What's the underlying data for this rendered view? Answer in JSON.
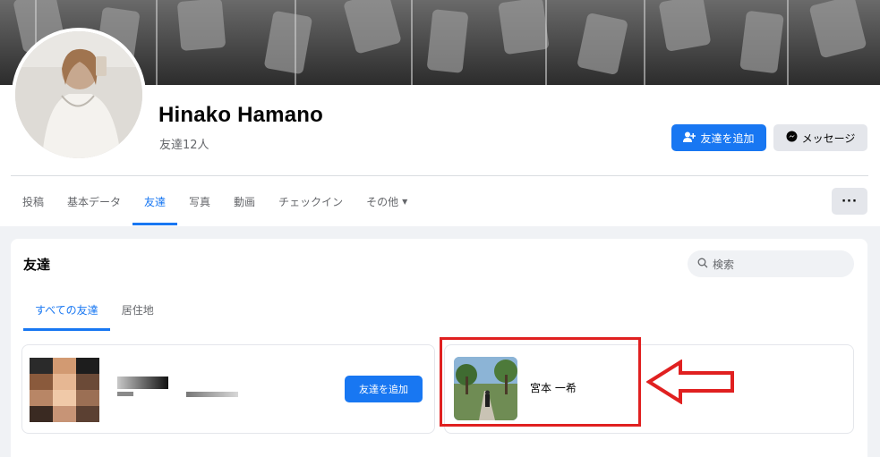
{
  "profile": {
    "name": "Hinako Hamano",
    "friends_count": "友達12人"
  },
  "actions": {
    "add_friend": "友達を追加",
    "message": "メッセージ",
    "more": "···"
  },
  "nav_tabs": [
    {
      "label": "投稿",
      "active": false
    },
    {
      "label": "基本データ",
      "active": false
    },
    {
      "label": "友達",
      "active": true
    },
    {
      "label": "写真",
      "active": false
    },
    {
      "label": "動画",
      "active": false
    },
    {
      "label": "チェックイン",
      "active": false
    },
    {
      "label": "その他",
      "active": false,
      "dropdown": true
    }
  ],
  "friends_section": {
    "title": "友達",
    "search_placeholder": "検索",
    "subtabs": [
      {
        "label": "すべての友達",
        "active": true
      },
      {
        "label": "居住地",
        "active": false
      }
    ],
    "friends": [
      {
        "name": "",
        "redacted": true,
        "action": "友達を追加"
      },
      {
        "name": "宮本 一希",
        "redacted": false,
        "highlighted": true
      }
    ]
  },
  "colors": {
    "accent": "#1877f2",
    "highlight": "#e02020",
    "background": "#f0f2f5"
  },
  "icons": [
    "person-add-icon",
    "messenger-icon",
    "search-icon",
    "caret-down-icon",
    "arrow-left-icon"
  ]
}
